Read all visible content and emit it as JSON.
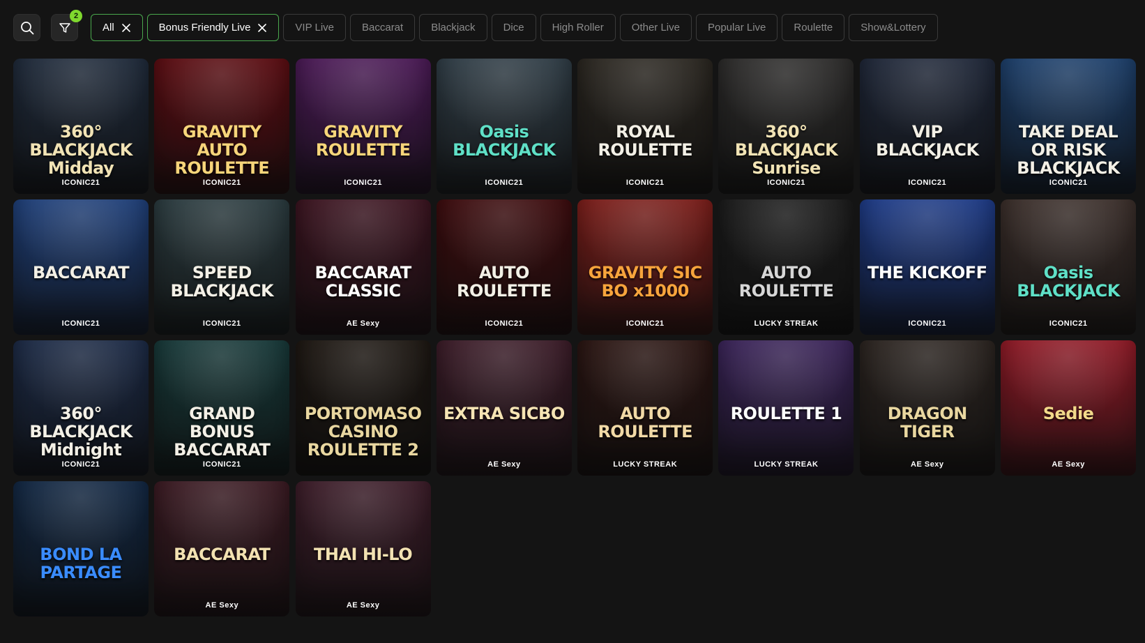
{
  "filters": {
    "badge_count": "2",
    "chips": [
      {
        "label": "All",
        "active": true,
        "removable": true
      },
      {
        "label": "Bonus Friendly Live",
        "active": true,
        "removable": true
      },
      {
        "label": "VIP Live",
        "active": false
      },
      {
        "label": "Baccarat",
        "active": false
      },
      {
        "label": "Blackjack",
        "active": false
      },
      {
        "label": "Dice",
        "active": false
      },
      {
        "label": "High Roller",
        "active": false
      },
      {
        "label": "Other Live",
        "active": false
      },
      {
        "label": "Popular Live",
        "active": false
      },
      {
        "label": "Roulette",
        "active": false
      },
      {
        "label": "Show&Lottery",
        "active": false
      }
    ]
  },
  "games": [
    {
      "title": "360° BLACKJACK Midday",
      "provider": "ICONIC21",
      "bg": "#1f2a3a",
      "color": "#f1e3b5"
    },
    {
      "title": "GRAVITY AUTO ROULETTE",
      "provider": "ICONIC21",
      "bg": "#5a0d12",
      "color": "#f7d57a"
    },
    {
      "title": "GRAVITY ROULETTE",
      "provider": "ICONIC21",
      "bg": "#4a1a55",
      "color": "#f7d57a"
    },
    {
      "title": "Oasis BLACKJACK",
      "provider": "ICONIC21",
      "bg": "#2f3c45",
      "color": "#5fe0c7"
    },
    {
      "title": "ROYAL ROULETTE",
      "provider": "ICONIC21",
      "bg": "#2a2620",
      "color": "#f3f0e6"
    },
    {
      "title": "360° BLACKJACK Sunrise",
      "provider": "ICONIC21",
      "bg": "#2c2b2a",
      "color": "#f1e3b5"
    },
    {
      "title": "VIP BLACKJACK",
      "provider": "ICONIC21",
      "bg": "#1f2738",
      "color": "#f3f0e6"
    },
    {
      "title": "TAKE DEAL OR RISK BLACKJACK",
      "provider": "ICONIC21",
      "bg": "#1d3f6a",
      "color": "#f3f0e6"
    },
    {
      "title": "BACCARAT",
      "provider": "ICONIC21",
      "bg": "#1f3f78",
      "color": "#f3f0e6"
    },
    {
      "title": "SPEED BLACKJACK",
      "provider": "ICONIC21",
      "bg": "#2a3a3e",
      "color": "#f3f0e6"
    },
    {
      "title": "BACCARAT CLASSIC",
      "provider": "AE Sexy",
      "bg": "#3b1420",
      "color": "#ffffff"
    },
    {
      "title": "AUTO ROULETTE",
      "provider": "ICONIC21",
      "bg": "#3c0c0e",
      "color": "#f3f0e6"
    },
    {
      "title": "GRAVITY SIC BO x1000",
      "provider": "ICONIC21",
      "bg": "#7a1e1a",
      "color": "#f7a43c"
    },
    {
      "title": "AUTO ROULETTE",
      "provider": "LUCKY STREAK",
      "bg": "#1b1b1b",
      "color": "#d6d6d6"
    },
    {
      "title": "THE KICKOFF",
      "provider": "ICONIC21",
      "bg": "#1e3b86",
      "color": "#ffffff"
    },
    {
      "title": "Oasis BLACKJACK",
      "provider": "ICONIC21",
      "bg": "#3a2e2a",
      "color": "#5fe0c7"
    },
    {
      "title": "360° BLACKJACK Midnight",
      "provider": "ICONIC21",
      "bg": "#1c2a45",
      "color": "#f3f0e6"
    },
    {
      "title": "GRAND BONUS BACCARAT",
      "provider": "ICONIC21",
      "bg": "#173838",
      "color": "#f3f0e6"
    },
    {
      "title": "PORTOMASO CASINO ROULETTE 2",
      "provider": "",
      "bg": "#1d1712",
      "color": "#e9d7a0"
    },
    {
      "title": "EXTRA SICBO",
      "provider": "AE Sexy",
      "bg": "#3b1c28",
      "color": "#f6e4b4"
    },
    {
      "title": "AUTO ROULETTE",
      "provider": "LUCKY STREAK",
      "bg": "#2a1512",
      "color": "#f1d9a6"
    },
    {
      "title": "ROULETTE 1",
      "provider": "LUCKY STREAK",
      "bg": "#3a2458",
      "color": "#ffffff"
    },
    {
      "title": "DRAGON TIGER",
      "provider": "AE Sexy",
      "bg": "#2b2420",
      "color": "#e9d7a0"
    },
    {
      "title": "Sedie",
      "provider": "AE Sexy",
      "bg": "#8e1a26",
      "color": "#f3d98a"
    },
    {
      "title": "BOND LA PARTAGE",
      "provider": "",
      "bg": "#122742",
      "color": "#3a8cff"
    },
    {
      "title": "BACCARAT",
      "provider": "AE Sexy",
      "bg": "#3a1a22",
      "color": "#f3e2b2"
    },
    {
      "title": "THAI HI-LO",
      "provider": "AE Sexy",
      "bg": "#3b1c28",
      "color": "#f3e2b2"
    }
  ]
}
